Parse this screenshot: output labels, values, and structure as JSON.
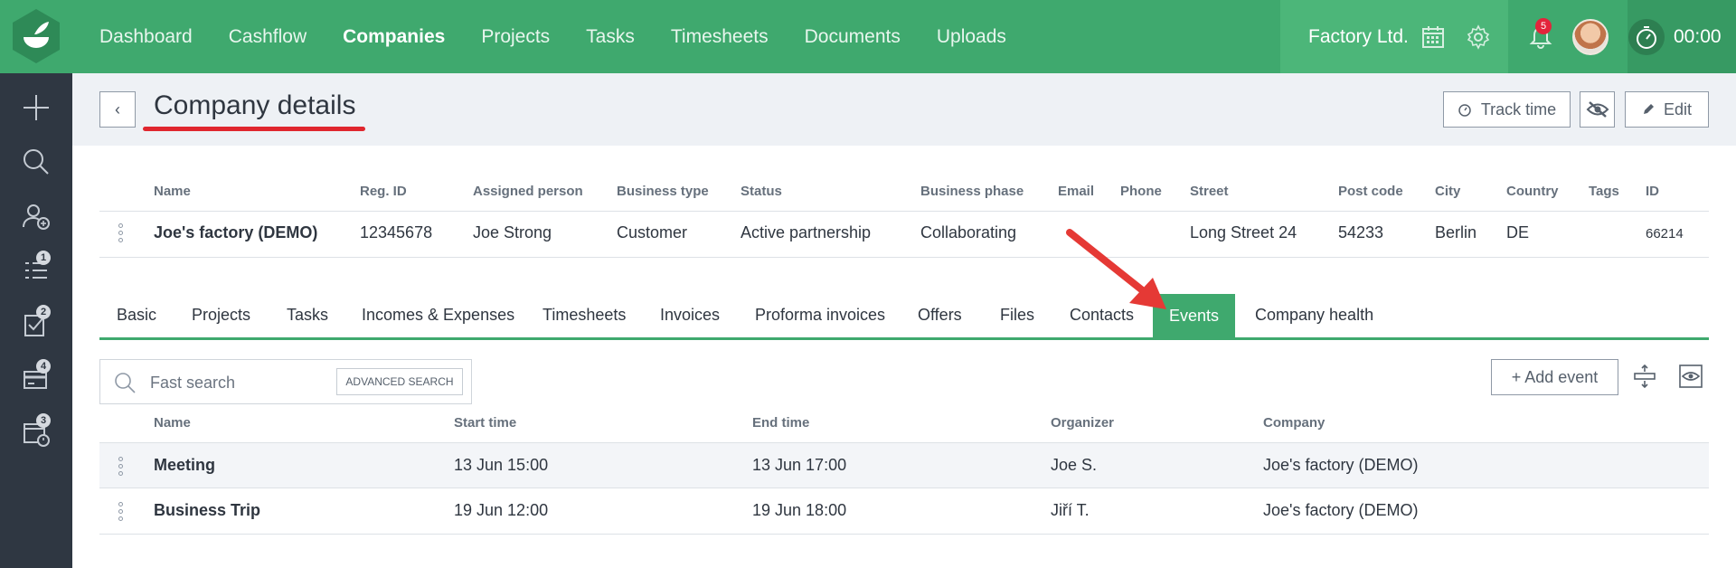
{
  "nav": {
    "items": [
      "Dashboard",
      "Cashflow",
      "Companies",
      "Projects",
      "Tasks",
      "Timesheets",
      "Documents",
      "Uploads"
    ],
    "active": "Companies"
  },
  "topbar": {
    "company": "Factory Ltd.",
    "notifications": "5",
    "timer": "00:00"
  },
  "sidebar": {
    "badges": [
      "1",
      "2",
      "4",
      "3"
    ]
  },
  "header": {
    "back": "‹",
    "title": "Company details",
    "track_time": "Track time",
    "edit": "Edit"
  },
  "company_table": {
    "headers": [
      "Name",
      "Reg. ID",
      "Assigned person",
      "Business type",
      "Status",
      "Business phase",
      "Email",
      "Phone",
      "Street",
      "Post code",
      "City",
      "Country",
      "Tags",
      "ID"
    ],
    "row": {
      "name": "Joe's factory (DEMO)",
      "reg_id": "12345678",
      "assigned": "Joe Strong",
      "type": "Customer",
      "status": "Active partnership",
      "phase": "Collaborating",
      "email": "",
      "phone": "",
      "street": "Long Street 24",
      "post": "54233",
      "city": "Berlin",
      "country": "DE",
      "tags": "",
      "id": "66214"
    }
  },
  "tabs": {
    "items": [
      "Basic",
      "Projects",
      "Tasks",
      "Incomes & Expenses",
      "Timesheets",
      "Invoices",
      "Proforma invoices",
      "Offers",
      "Files",
      "Contacts",
      "Events",
      "Company health"
    ],
    "active": "Events"
  },
  "search": {
    "placeholder": "Fast search",
    "advanced": "ADVANCED SEARCH"
  },
  "add_event": "+ Add event",
  "events_table": {
    "headers": [
      "Name",
      "Start time",
      "End time",
      "Organizer",
      "Company"
    ],
    "rows": [
      {
        "name": "Meeting",
        "start": "13 Jun 15:00",
        "end": "13 Jun 17:00",
        "organizer": "Joe S.",
        "company": "Joe's factory (DEMO)"
      },
      {
        "name": "Business Trip",
        "start": "19 Jun 12:00",
        "end": "19 Jun 18:00",
        "organizer": "Jiří T.",
        "company": "Joe's factory (DEMO)"
      }
    ]
  },
  "colors": {
    "green": "#3fa96e",
    "sidebar": "#2f3742",
    "annotation_red": "#e0262e"
  }
}
